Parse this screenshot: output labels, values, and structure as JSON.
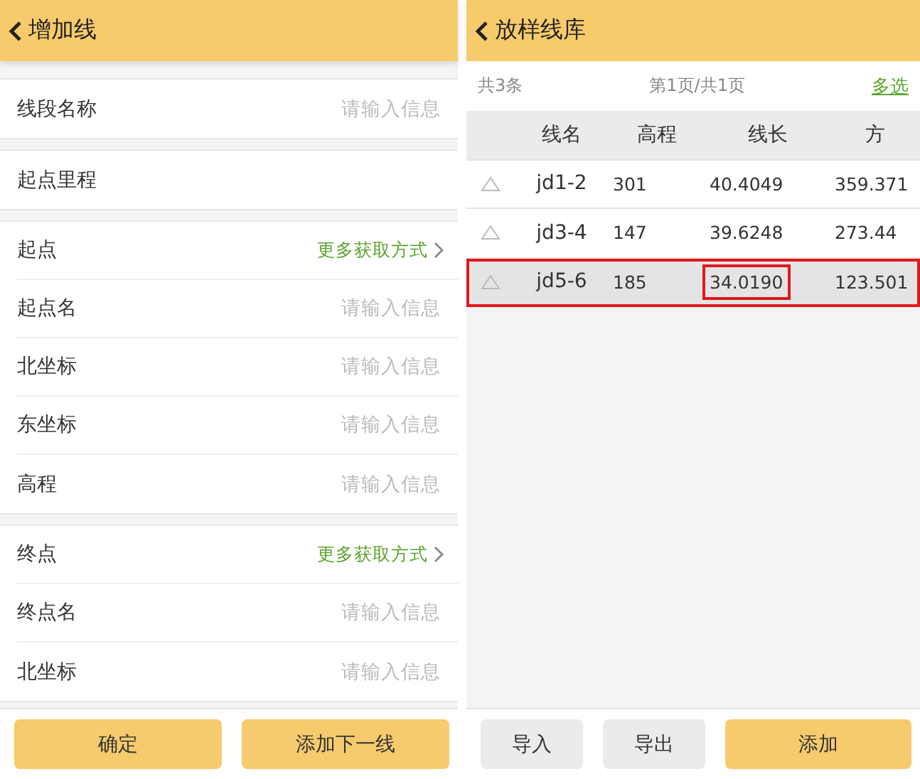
{
  "form_screen": {
    "title": "增加线",
    "sections": [
      {
        "rows": [
          {
            "label": "线段名称",
            "kind": "input",
            "placeholder": "请输入信息"
          }
        ]
      },
      {
        "rows": [
          {
            "label": "起点里程",
            "kind": "plain"
          }
        ]
      },
      {
        "rows": [
          {
            "label": "起点",
            "kind": "picker",
            "link": "更多获取方式"
          },
          {
            "label": "起点名",
            "kind": "input",
            "placeholder": "请输入信息"
          },
          {
            "label": "北坐标",
            "kind": "input",
            "placeholder": "请输入信息"
          },
          {
            "label": "东坐标",
            "kind": "input",
            "placeholder": "请输入信息"
          },
          {
            "label": "高程",
            "kind": "input",
            "placeholder": "请输入信息"
          }
        ]
      },
      {
        "rows": [
          {
            "label": "终点",
            "kind": "picker",
            "link": "更多获取方式"
          },
          {
            "label": "终点名",
            "kind": "input",
            "placeholder": "请输入信息"
          },
          {
            "label": "北坐标",
            "kind": "input",
            "placeholder": "请输入信息"
          }
        ]
      }
    ],
    "buttons": [
      "确定",
      "添加下一线"
    ]
  },
  "library_screen": {
    "title": "放样线库",
    "count": "共3条",
    "page": "第1页/共1页",
    "multi_select": "多选",
    "table": {
      "columns": [
        "线名",
        "高程",
        "线长",
        "方"
      ],
      "rows": [
        {
          "cells": [
            {
              "text": "jd1-2",
              "highlighted": false
            },
            {
              "text": "301",
              "highlighted": false
            },
            {
              "text": "40.4049",
              "highlighted": false
            },
            {
              "text": "359.371",
              "highlighted": false
            }
          ],
          "selected": false,
          "highlighted": false
        },
        {
          "cells": [
            {
              "text": "jd3-4",
              "highlighted": false
            },
            {
              "text": "147",
              "highlighted": false
            },
            {
              "text": "39.6248",
              "highlighted": false
            },
            {
              "text": "273.44",
              "highlighted": false
            }
          ],
          "selected": false,
          "highlighted": false
        },
        {
          "cells": [
            {
              "text": "jd5-6",
              "highlighted": false
            },
            {
              "text": "185",
              "highlighted": false
            },
            {
              "text": "34.0190",
              "highlighted": true
            },
            {
              "text": "123.501",
              "highlighted": false
            }
          ],
          "selected": true,
          "highlighted": true
        }
      ]
    },
    "buttons": [
      {
        "label": "导入",
        "kind": "secondary"
      },
      {
        "label": "导出",
        "kind": "secondary"
      },
      {
        "label": "添加",
        "kind": "primary"
      }
    ]
  }
}
